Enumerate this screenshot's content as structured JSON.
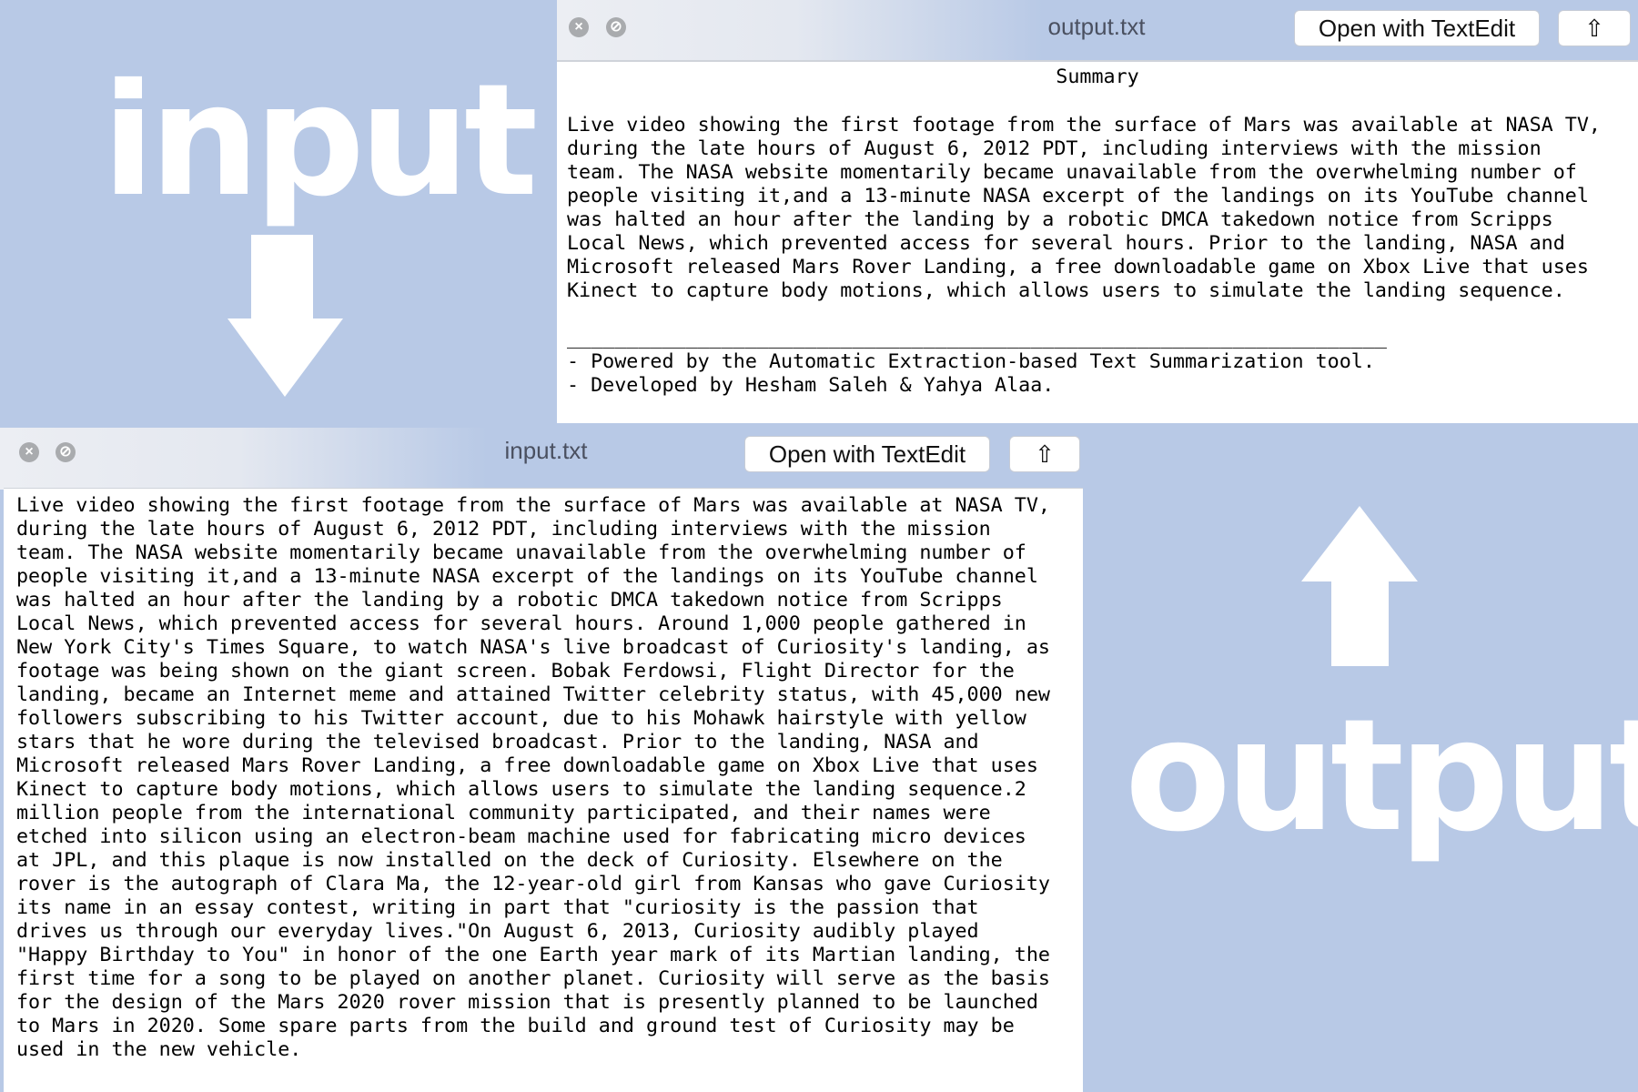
{
  "labels": {
    "input": "input",
    "output": "output"
  },
  "output_window": {
    "title": "output.txt",
    "open_button": "Open with TextEdit",
    "heading": "Summary",
    "lines": [
      "Live video showing the first footage from the surface of Mars was available at NASA TV,",
      "during the late hours of August 6, 2012 PDT, including interviews with the mission",
      "team. The NASA website momentarily became unavailable from the overwhelming number of",
      "people visiting it,and a 13-minute NASA excerpt of the landings on its YouTube channel",
      "was halted an hour after the landing by a robotic DMCA takedown notice from Scripps",
      "Local News, which prevented access for several hours. Prior to the landing, NASA and",
      "Microsoft released Mars Rover Landing, a free downloadable game on Xbox Live that uses",
      "Kinect to capture body motions, which allows users to simulate the landing sequence.",
      "",
      "_____________________________________________________________________",
      "- Powered by the Automatic Extraction-based Text Summarization tool.",
      "- Developed by Hesham Saleh & Yahya Alaa."
    ]
  },
  "input_window": {
    "title": "input.txt",
    "open_button": "Open with TextEdit",
    "lines": [
      "Live video showing the first footage from the surface of Mars was available at NASA TV,",
      "during the late hours of August 6, 2012 PDT, including interviews with the mission",
      "team. The NASA website momentarily became unavailable from the overwhelming number of",
      "people visiting it,and a 13-minute NASA excerpt of the landings on its YouTube channel",
      "was halted an hour after the landing by a robotic DMCA takedown notice from Scripps",
      "Local News, which prevented access for several hours. Around 1,000 people gathered in",
      "New York City's Times Square, to watch NASA's live broadcast of Curiosity's landing, as",
      "footage was being shown on the giant screen. Bobak Ferdowsi, Flight Director for the",
      "landing, became an Internet meme and attained Twitter celebrity status, with 45,000 new",
      "followers subscribing to his Twitter account, due to his Mohawk hairstyle with yellow",
      "stars that he wore during the televised broadcast. Prior to the landing, NASA and",
      "Microsoft released Mars Rover Landing, a free downloadable game on Xbox Live that uses",
      "Kinect to capture body motions, which allows users to simulate the landing sequence.2",
      "million people from the international community participated, and their names were",
      "etched into silicon using an electron-beam machine used for fabricating micro devices",
      "at JPL, and this plaque is now installed on the deck of Curiosity. Elsewhere on the",
      "rover is the autograph of Clara Ma, the 12-year-old girl from Kansas who gave Curiosity",
      "its name in an essay contest, writing in part that \"curiosity is the passion that",
      "drives us through our everyday lives.\"On August 6, 2013, Curiosity audibly played",
      "\"Happy Birthday to You\" in honor of the one Earth year mark of its Martian landing, the",
      "first time for a song to be played on another planet. Curiosity will serve as the basis",
      "for the design of the Mars 2020 rover mission that is presently planned to be launched",
      "to Mars in 2020. Some spare parts from the build and ground test of Curiosity may be",
      "used in the new vehicle."
    ]
  },
  "colors": {
    "background": "#b8c9e6",
    "arrow": "#ffffff"
  }
}
